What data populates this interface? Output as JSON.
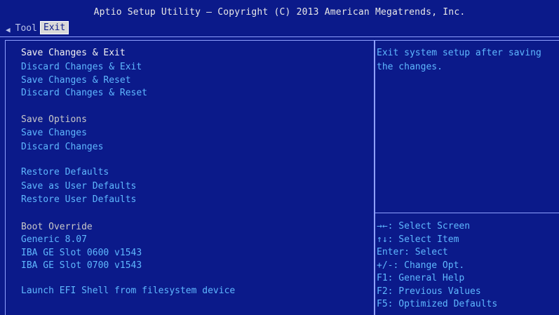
{
  "header": {
    "title": "Aptio Setup Utility – Copyright (C) 2013 American Megatrends, Inc.",
    "tab_prev_arrow": "◀",
    "tabs": [
      {
        "label": "Tool",
        "active": false
      },
      {
        "label": "Exit",
        "active": true
      }
    ]
  },
  "menu": {
    "save_changes_exit": "Save Changes & Exit",
    "discard_changes_exit": "Discard Changes & Exit",
    "save_changes_reset": "Save Changes & Reset",
    "discard_changes_reset": "Discard Changes & Reset",
    "save_options_label": "Save Options",
    "save_changes": "Save Changes",
    "discard_changes": "Discard Changes",
    "restore_defaults": "Restore Defaults",
    "save_user_defaults": "Save as User Defaults",
    "restore_user_defaults": "Restore User Defaults",
    "boot_override_label": "Boot Override",
    "boot_generic": "Generic 8.07",
    "boot_iba_0600": "IBA GE Slot 0600 v1543",
    "boot_iba_0700": "IBA GE Slot 0700 v1543",
    "launch_efi_shell": "Launch EFI Shell from filesystem device"
  },
  "help": {
    "description": "Exit system setup after saving the changes."
  },
  "keys": {
    "select_screen": "→←: Select Screen",
    "select_item": "↑↓: Select Item",
    "enter_select": "Enter: Select",
    "change_opt": "+/-: Change Opt.",
    "general_help": "F1: General Help",
    "previous_values": "F2: Previous Values",
    "optimized_defaults": "F5: Optimized Defaults"
  },
  "colors": {
    "background": "#0b1a8a",
    "border": "#8fa0ff",
    "selected_text": "#f2f2f2",
    "link_text": "#5fb8ff",
    "label_text": "#c8c8c8"
  }
}
